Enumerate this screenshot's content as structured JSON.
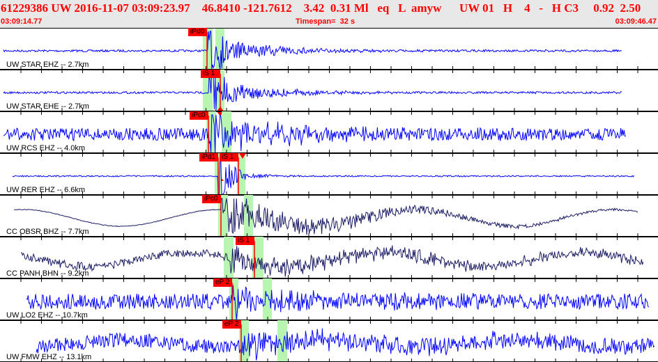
{
  "header": {
    "title": "61229386 UW 2016-11-07 03:09:23.97    46.8410 -121.7612    3.42  0.31 Ml   eq   L  amyw      UW 01   H    4   -   H C3     0.92  2.50",
    "start_time": "03:09:14.77",
    "timespan": "Timespan=  32 s",
    "end_time": "03:09:46.47"
  },
  "colors": {
    "header_text": "#ff0000",
    "trace_short": "#0000ff",
    "trace_broadband": "#1c1c66",
    "pick": "#ff0000",
    "window": "#b8f5b0"
  },
  "traces": [
    {
      "label": "UW STAR EHZ -- 2.7km",
      "picks": [
        "iPd0"
      ]
    },
    {
      "label": "UW STAR EHE -- 2.7km",
      "picks": [
        "iS 1"
      ]
    },
    {
      "label": "UW RCS EHZ -- 4.0km",
      "picks": [
        "iPc0"
      ]
    },
    {
      "label": "UW RER EHZ -- 6.6km",
      "picks": [
        "iPd1",
        "iS 1"
      ]
    },
    {
      "label": "CC OBSR BHZ -- 7.7km",
      "picks": [
        "iPc0"
      ]
    },
    {
      "label": "CC PANH BHN -- 9.2km",
      "picks": [
        "iS 1"
      ]
    },
    {
      "label": "UW LO2 EHZ -- 10.7km",
      "picks": [
        "eP 2"
      ]
    },
    {
      "label": "UW FMW EHZ -- 13.1km",
      "picks": [
        "eP 2"
      ]
    }
  ]
}
